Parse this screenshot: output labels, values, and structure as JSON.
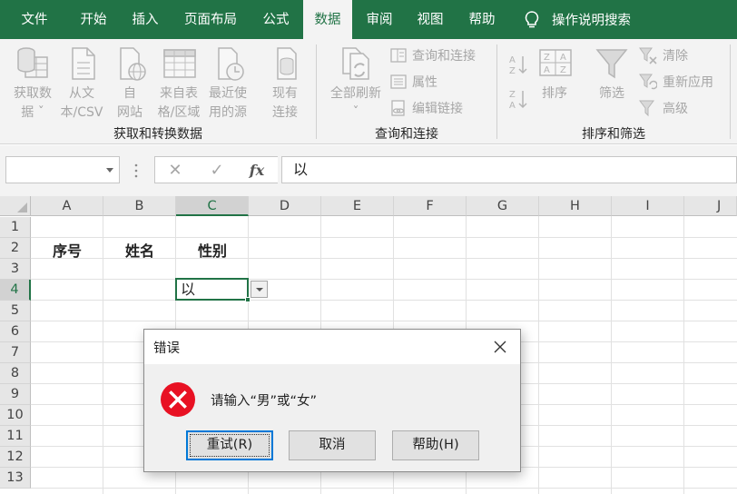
{
  "tabs": [
    "文件",
    "开始",
    "插入",
    "页面布局",
    "公式",
    "数据",
    "审阅",
    "视图",
    "帮助"
  ],
  "active_tab": "数据",
  "tell_me": "操作说明搜索",
  "ribbon": {
    "get_data": {
      "buttons": [
        {
          "line1": "获取数",
          "line2": "据 ˇ"
        },
        {
          "line1": "从文",
          "line2": "本/CSV"
        },
        {
          "line1": "自",
          "line2": "网站"
        },
        {
          "line1": "来自表",
          "line2": "格/区域"
        },
        {
          "line1": "最近使",
          "line2": "用的源"
        },
        {
          "line1": "现有",
          "line2": "连接"
        }
      ],
      "label": "获取和转换数据"
    },
    "queries": {
      "refresh_line1": "全部刷新",
      "refresh_line2": "ˇ",
      "items": [
        "查询和连接",
        "属性",
        "编辑链接"
      ],
      "label": "查询和连接"
    },
    "sort_filter": {
      "sort_label": "排序",
      "filter_label": "筛选",
      "items": [
        "清除",
        "重新应用",
        "高级"
      ],
      "label": "排序和筛选"
    }
  },
  "formula_bar": {
    "name_box": "",
    "fx": "fx",
    "content": "以"
  },
  "columns": [
    "A",
    "B",
    "C",
    "D",
    "E",
    "F",
    "G",
    "H",
    "I",
    "J"
  ],
  "selected_column": "C",
  "rows": [
    "1",
    "2",
    "3",
    "4",
    "5",
    "6",
    "7",
    "8",
    "9",
    "10",
    "11",
    "12",
    "13"
  ],
  "selected_row": "4",
  "cells": {
    "A2": "序号",
    "B2": "姓名",
    "C2": "性别",
    "C4": "以"
  },
  "dialog": {
    "title": "错误",
    "message": "请输入“男”或“女”",
    "buttons": [
      "重试(R)",
      "取消",
      "帮助(H)"
    ]
  },
  "colors": {
    "accent": "#217346",
    "error": "#e81123",
    "focus": "#0078d7"
  }
}
